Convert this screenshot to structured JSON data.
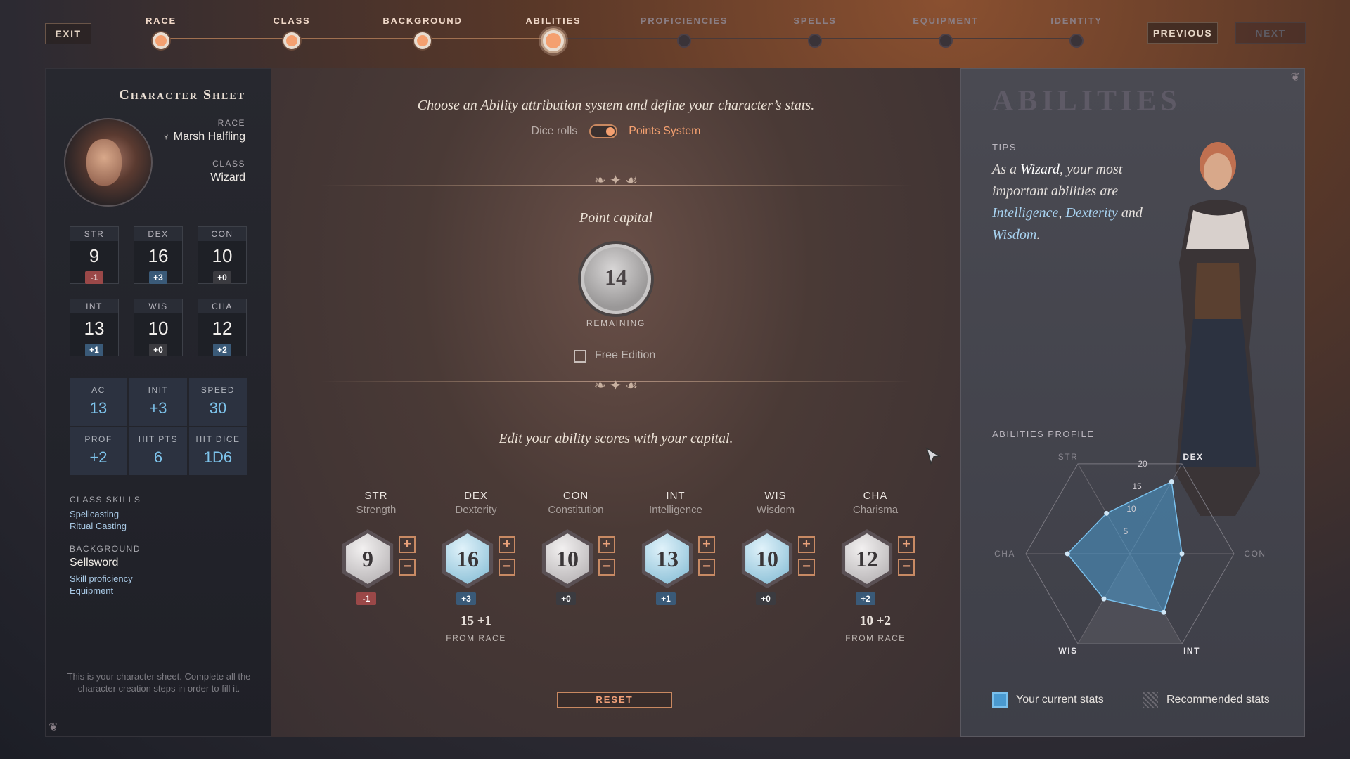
{
  "nav": {
    "exit": "EXIT",
    "previous": "PREVIOUS",
    "next": "NEXT",
    "steps": [
      {
        "label": "RACE",
        "state": "done"
      },
      {
        "label": "CLASS",
        "state": "done"
      },
      {
        "label": "BACKGROUND",
        "state": "done"
      },
      {
        "label": "ABILITIES",
        "state": "current"
      },
      {
        "label": "PROFICIENCIES",
        "state": "future"
      },
      {
        "label": "SPELLS",
        "state": "future"
      },
      {
        "label": "EQUIPMENT",
        "state": "future"
      },
      {
        "label": "IDENTITY",
        "state": "future"
      }
    ]
  },
  "sheet": {
    "title": "Character Sheet",
    "race_label": "RACE",
    "race_symbol": "♀",
    "race": "Marsh Halfling",
    "class_label": "CLASS",
    "class": "Wizard",
    "abilities": [
      {
        "key": "STR",
        "value": "9",
        "mod": "-1",
        "sign": "neg"
      },
      {
        "key": "DEX",
        "value": "16",
        "mod": "+3",
        "sign": "pos"
      },
      {
        "key": "CON",
        "value": "10",
        "mod": "+0",
        "sign": "zero"
      },
      {
        "key": "INT",
        "value": "13",
        "mod": "+1",
        "sign": "pos"
      },
      {
        "key": "WIS",
        "value": "10",
        "mod": "+0",
        "sign": "zero"
      },
      {
        "key": "CHA",
        "value": "12",
        "mod": "+2",
        "sign": "pos"
      }
    ],
    "derived": [
      {
        "label": "AC",
        "value": "13"
      },
      {
        "label": "INIT",
        "value": "+3"
      },
      {
        "label": "SPEED",
        "value": "30"
      },
      {
        "label": "PROF",
        "value": "+2"
      },
      {
        "label": "HIT PTS",
        "value": "6"
      },
      {
        "label": "HIT DICE",
        "value": "1D6"
      }
    ],
    "class_skills_label": "CLASS SKILLS",
    "class_skills": [
      "Spellcasting",
      "Ritual Casting"
    ],
    "background_label": "BACKGROUND",
    "background": "Sellsword",
    "background_items": [
      "Skill proficiency",
      "Equipment"
    ],
    "footnote": "This is your character sheet. Complete all the character creation steps in order to fill it."
  },
  "main": {
    "instruction": "Choose an Ability attribution system and define your character’s stats.",
    "toggle_left": "Dice rolls",
    "toggle_right": "Points System",
    "point_capital_label": "Point capital",
    "points_remaining": "14",
    "remaining_label": "REMAINING",
    "free_edition": "Free Edition",
    "edit_instruction": "Edit your ability scores with your capital.",
    "reset": "RESET",
    "plus": "+",
    "minus": "−",
    "abilities": [
      {
        "key": "STR",
        "name": "Strength",
        "value": "9",
        "mod": "-1",
        "sign": "neg",
        "tone": "gray",
        "race_bonus": "",
        "race_label": ""
      },
      {
        "key": "DEX",
        "name": "Dexterity",
        "value": "16",
        "mod": "+3",
        "sign": "pos",
        "tone": "blue",
        "race_bonus": "15 +1",
        "race_label": "FROM RACE"
      },
      {
        "key": "CON",
        "name": "Constitution",
        "value": "10",
        "mod": "+0",
        "sign": "zero",
        "tone": "gray",
        "race_bonus": "",
        "race_label": ""
      },
      {
        "key": "INT",
        "name": "Intelligence",
        "value": "13",
        "mod": "+1",
        "sign": "pos",
        "tone": "blue",
        "race_bonus": "",
        "race_label": ""
      },
      {
        "key": "WIS",
        "name": "Wisdom",
        "value": "10",
        "mod": "+0",
        "sign": "zero",
        "tone": "blue",
        "race_bonus": "",
        "race_label": ""
      },
      {
        "key": "CHA",
        "name": "Charisma",
        "value": "12",
        "mod": "+2",
        "sign": "pos",
        "tone": "gray",
        "race_bonus": "10 +2",
        "race_label": "FROM RACE"
      }
    ]
  },
  "panel": {
    "title": "ABILITIES",
    "tips_label": "TIPS",
    "tips_parts": {
      "p1": "As a ",
      "class": "Wizard",
      "p2": ", your most important abilities are ",
      "a1": "Intelligence",
      "p3": ", ",
      "a2": "Dexterity",
      "p4": " and ",
      "a3": "Wisdom",
      "p5": "."
    },
    "profile_label": "ABILITIES PROFILE",
    "legend_current": "Your current stats",
    "legend_recommended": "Recommended stats"
  },
  "chart_data": {
    "type": "radar",
    "axes": [
      "DEX",
      "CON",
      "INT",
      "WIS",
      "CHA",
      "STR"
    ],
    "rmax": 20,
    "ticks": [
      "5",
      "10",
      "15",
      "20"
    ],
    "series": [
      {
        "name": "Your current stats",
        "values": [
          16,
          10,
          13,
          10,
          12,
          9
        ]
      }
    ],
    "colors": {
      "current": "#4a9ad0",
      "recommended": "#8a8890"
    }
  }
}
